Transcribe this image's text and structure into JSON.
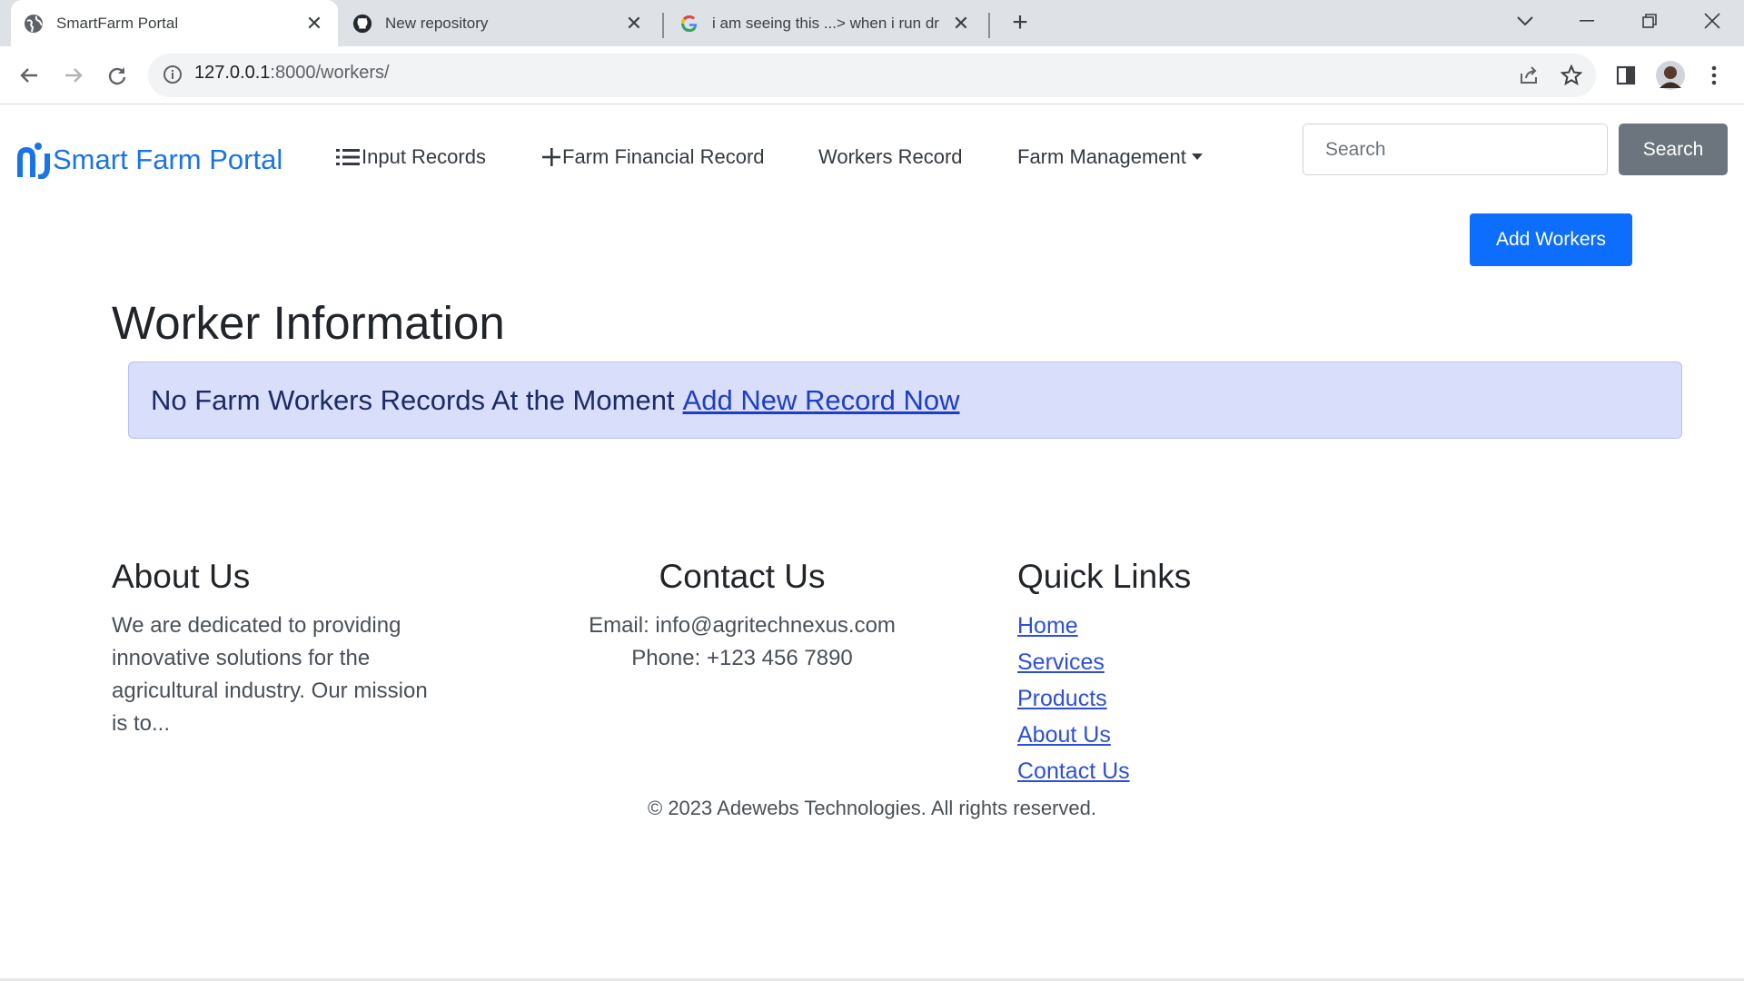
{
  "browser": {
    "tabs": [
      {
        "title": "SmartFarm Portal",
        "favicon": "globe-icon",
        "active": true
      },
      {
        "title": "New repository",
        "favicon": "github-icon",
        "active": false
      },
      {
        "title": "i am seeing this ...> when i run dr",
        "favicon": "google-icon",
        "active": false
      }
    ],
    "url_host": "127.0.0.1",
    "url_path": ":8000/workers/"
  },
  "navbar": {
    "brand": "Smart Farm Portal",
    "links": [
      {
        "label": "Input Records",
        "icon": "list-icon"
      },
      {
        "label": "Farm Financial Record",
        "icon": "plus-icon"
      },
      {
        "label": "Workers Record"
      },
      {
        "label": "Farm Management",
        "icon": "caret-down-icon"
      }
    ],
    "search_placeholder": "Search",
    "search_button": "Search"
  },
  "main": {
    "add_button": "Add Workers",
    "title": "Worker Information",
    "alert_text": "No Farm Workers Records At the Moment",
    "alert_link": "Add New Record Now"
  },
  "footer": {
    "about": {
      "heading": "About Us",
      "lines": [
        "We are dedicated to providing",
        "innovative solutions for the",
        "agricultural industry. Our mission",
        "is to..."
      ]
    },
    "contact": {
      "heading": "Contact Us",
      "email": "Email: info@agritechnexus.com",
      "phone": "Phone: +123 456 7890"
    },
    "quick_links": {
      "heading": "Quick Links",
      "links": [
        "Home",
        "Services",
        "Products",
        "About Us",
        "Contact Us"
      ]
    },
    "copyright": "© 2023 Adewebs Technologies. All rights reserved."
  },
  "colors": {
    "brand": "#1a73e8",
    "primary_button": "#0d6efd",
    "secondary_button": "#6c757d",
    "alert_bg": "#d9defa"
  }
}
